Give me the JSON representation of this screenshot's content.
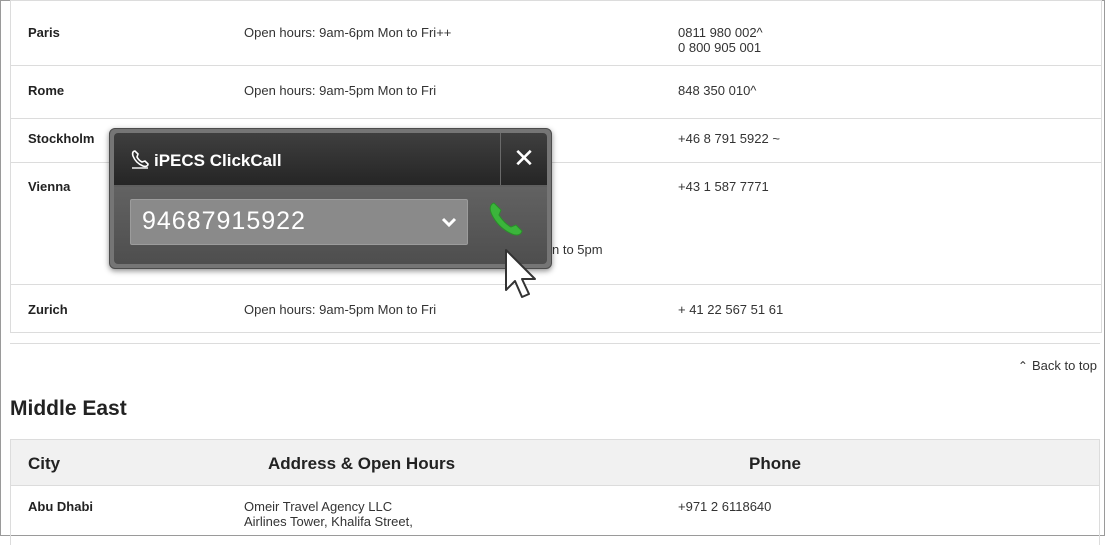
{
  "rows": [
    {
      "city": "Paris",
      "address": [
        "Open hours: 9am-6pm Mon to Fri++"
      ],
      "phone": [
        "0811 980 002^",
        "0 800 905 001"
      ]
    },
    {
      "city": "Rome",
      "address": [
        "Open hours: 9am-5pm Mon to Fri"
      ],
      "phone": [
        "848 350 010^"
      ]
    },
    {
      "city": "Stockholm",
      "address": [],
      "phone": [
        "+46 8 791 5922 ~"
      ]
    },
    {
      "city": "Vienna",
      "address_fragment": "n to 5pm",
      "phone": [
        "+43 1 587 7771"
      ]
    },
    {
      "city": "Zurich",
      "address": [
        "Open hours: 9am-5pm Mon to Fri"
      ],
      "phone": [
        "+ 41 22 567 51 61"
      ]
    }
  ],
  "back_to_top": "Back to top",
  "section_title": "Middle East",
  "table_headers": {
    "city": "City",
    "address": "Address & Open Hours",
    "phone": "Phone"
  },
  "middle_east_rows": [
    {
      "city": "Abu Dhabi",
      "address": [
        "Omeir Travel Agency LLC",
        "Airlines Tower, Khalifa Street,"
      ],
      "phone": [
        "+971 2 6118640"
      ]
    }
  ],
  "popup": {
    "title": "iPECS ClickCall",
    "close_label": "✕",
    "number": "94687915922"
  },
  "colors": {
    "call_green": "#3bb53b",
    "popup_dark": "#2c2c2c"
  }
}
